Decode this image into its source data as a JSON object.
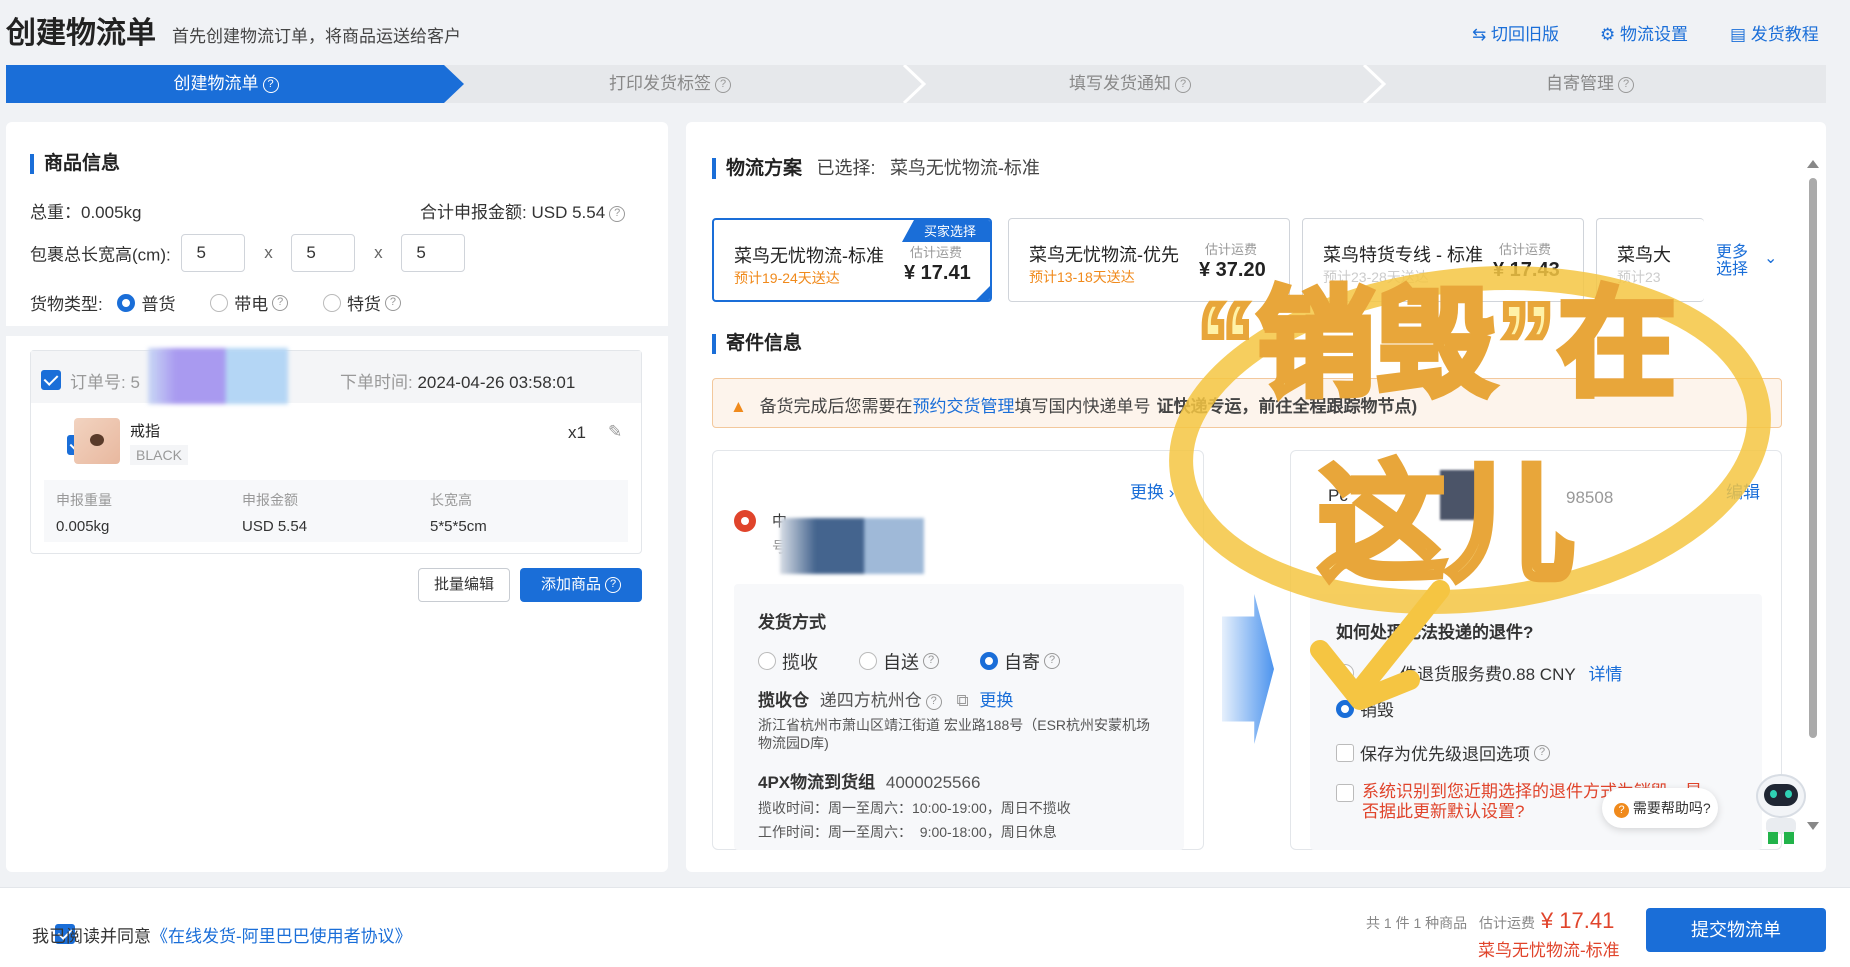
{
  "header": {
    "title": "创建物流单",
    "subtitle": "首先创建物流订单，将商品运送给客户",
    "links": [
      "切回旧版",
      "物流设置",
      "发货教程"
    ]
  },
  "steps": [
    "创建物流单",
    "打印发货标签",
    "填写发货通知",
    "自寄管理"
  ],
  "goods": {
    "title": "商品信息",
    "weight_label": "总重：",
    "weight": "0.005kg",
    "declared_label": "合计申报金额:",
    "declared": "USD 5.54",
    "dims_label": "包裹总长宽高(cm):",
    "dims": [
      "5",
      "5",
      "5"
    ],
    "dim_sep": "x",
    "type_label": "货物类型:",
    "types": [
      "普货",
      "带电",
      "特货"
    ],
    "order_label": "订单号:",
    "order_prefix": "5",
    "order_time_label": "下单时间:",
    "order_time": "2024-04-26 03:58:01",
    "item_name": "戒指",
    "item_variant": "BLACK",
    "item_qty": "x1",
    "detail_headers": [
      "申报重量",
      "申报金额",
      "长宽高"
    ],
    "detail_values": [
      "0.005kg",
      "USD 5.54",
      "5*5*5cm"
    ],
    "batch_edit": "批量编辑",
    "add_goods": "添加商品"
  },
  "logistics": {
    "title": "物流方案",
    "selected_label": "已选择:",
    "selected": "菜鸟无忧物流-标准",
    "buyer_choice": "买家选择",
    "est_label": "估计运费",
    "options": [
      {
        "name": "菜鸟无忧物流-标准",
        "delivery": "预计19-24天送达",
        "price": "¥ 17.41"
      },
      {
        "name": "菜鸟无忧物流-优先",
        "delivery": "预计13-18天送达",
        "price": "¥ 37.20"
      },
      {
        "name": "菜鸟特货专线 - 标准",
        "delivery": "预计23-28天送达",
        "price": "¥ 17.43"
      },
      {
        "name": "菜鸟大",
        "delivery": "预计23",
        "price": ""
      }
    ],
    "more": "更多选择"
  },
  "sender": {
    "title": "寄件信息",
    "notice_a": "备货完成后您需要在",
    "notice_link": "预约交货管理",
    "notice_b": "填写国内快递单号",
    "notice_c": "证快递专运，前往全程跟踪物节点)",
    "change": "更换",
    "addr_prefix": "中",
    "addr_prefix2": "号",
    "ship_method": "发货方式",
    "methods": [
      "揽收",
      "自送",
      "自寄"
    ],
    "warehouse_label": "揽收仓",
    "warehouse": "递四方杭州仓",
    "warehouse_change": "更换",
    "address": "浙江省杭州市萧山区靖江街道 宏业路188号（ESR杭州安蒙机场物流园D库)",
    "group_label": "4PX物流到货组",
    "group_phone": "4000025566",
    "pickup_time": "揽收时间：周一至周六：10:00-19:00，周日不揽收",
    "work_time": "工作时间：周一至周六：  9:00-18:00，周日休息"
  },
  "receiver": {
    "edit": "编辑",
    "name_prefix": "Pc",
    "phone_partial": "98508",
    "return_q": "如何处理无法投递的退件?",
    "return_opt1": "件退货服务费0.88 CNY",
    "return_detail": "详情",
    "return_opt2": "销毁",
    "save_priority": "保存为优先级退回选项",
    "sys_notice": "系统识别到您近期选择的退件方式为销毁，是否据此更新默认设置?",
    "help": "需要帮助吗?"
  },
  "overlay": {
    "line1": "“销毁”在",
    "line2": "这儿"
  },
  "footer": {
    "agree_label": "我已阅读并同意",
    "agree_link": "《在线发货-阿里巴巴使用者协议》",
    "count_text": "共 1 件 1 种商品",
    "est_label": "估计运费",
    "total": "¥ 17.41",
    "plan": "菜鸟无忧物流-标准",
    "submit": "提交物流单"
  },
  "colors": {
    "accent": "#1a6ed8",
    "orange": "#f08a1c",
    "red": "#e0442b",
    "overlay": "#f5c542"
  }
}
